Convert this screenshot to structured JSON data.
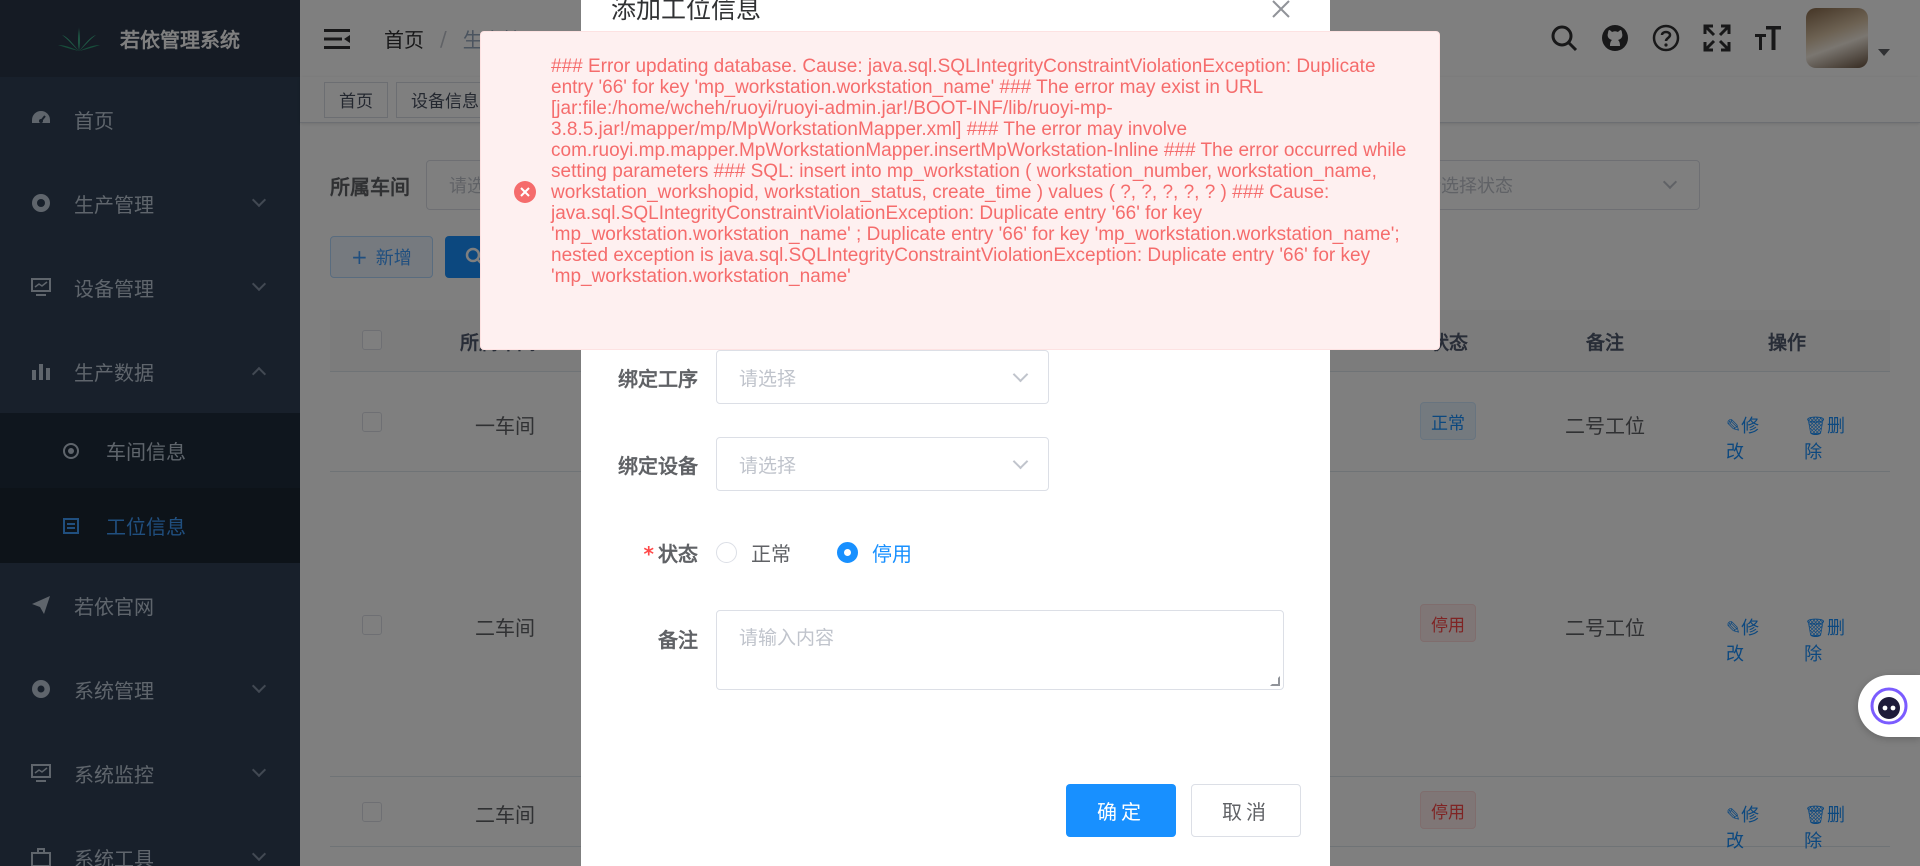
{
  "app": {
    "title": "若依管理系统"
  },
  "sidebar": {
    "items": [
      {
        "label": "首页",
        "icon": "dashboard-icon"
      },
      {
        "label": "生产管理",
        "icon": "settings-gear-icon"
      },
      {
        "label": "设备管理",
        "icon": "monitor-icon"
      },
      {
        "label": "生产数据",
        "icon": "bar-chart-icon"
      },
      {
        "label": "若依官网",
        "icon": "send-icon"
      },
      {
        "label": "系统管理",
        "icon": "system-gear-icon"
      },
      {
        "label": "系统监控",
        "icon": "monitor-icon"
      },
      {
        "label": "系统工具",
        "icon": "toolbox-icon"
      }
    ],
    "submenu": [
      {
        "label": "车间信息"
      },
      {
        "label": "工位信息"
      }
    ]
  },
  "navbar": {
    "breadcrumb_home": "首页",
    "breadcrumb_sep": "/",
    "breadcrumb_current": "生产管理"
  },
  "tags": [
    {
      "label": "首页"
    },
    {
      "label": "设备信息"
    }
  ],
  "filters": {
    "workshop_label": "所属车间",
    "workshop_placeholder": "请选择",
    "status_placeholder": "请选择状态"
  },
  "toolbar": {
    "add_label": "新增"
  },
  "table": {
    "headers": {
      "workshop": "所属车间",
      "status": "状态",
      "remark": "备注",
      "ops": "操作"
    },
    "rows": [
      {
        "workshop": "一车间",
        "status": "正常",
        "status_type": "ok",
        "remark": "二号工位"
      },
      {
        "workshop": "二车间",
        "status": "停用",
        "status_type": "stop",
        "remark": "二号工位"
      },
      {
        "workshop": "二车间",
        "status": "停用",
        "status_type": "stop",
        "remark": ""
      }
    ],
    "edit_label": "修改",
    "delete_label": "删除"
  },
  "dialog": {
    "title": "添加工位信息",
    "process_label": "绑定工序",
    "process_placeholder": "请选择",
    "device_label": "绑定设备",
    "device_placeholder": "请选择",
    "status_label": "状态",
    "status_required_mark": "*",
    "status_options": [
      {
        "label": "正常"
      },
      {
        "label": "停用"
      }
    ],
    "status_selected": "停用",
    "remark_label": "备注",
    "remark_placeholder": "请输入内容",
    "confirm_label": "确定",
    "cancel_label": "取消"
  },
  "error": {
    "message": "### Error updating database. Cause: java.sql.SQLIntegrityConstraintViolationException: Duplicate entry '66' for key 'mp_workstation.workstation_name' ### The error may exist in URL [jar:file:/home/wcheh/ruoyi/ruoyi-admin.jar!/BOOT-INF/lib/ruoyi-mp-3.8.5.jar!/mapper/mp/MpWorkstationMapper.xml] ### The error may involve com.ruoyi.mp.mapper.MpWorkstationMapper.insertMpWorkstation-Inline ### The error occurred while setting parameters ### SQL: insert into mp_workstation ( workstation_number, workstation_name, workstation_workshopid, workstation_status, create_time ) values ( ?, ?, ?, ?, ? ) ### Cause: java.sql.SQLIntegrityConstraintViolationException: Duplicate entry '66' for key 'mp_workstation.workstation_name' ; Duplicate entry '66' for key 'mp_workstation.workstation_name'; nested exception is java.sql.SQLIntegrityConstraintViolationException: Duplicate entry '66' for key 'mp_workstation.workstation_name'",
    "color": "#f56c6c"
  },
  "colors": {
    "primary": "#1890ff",
    "sidebar": "#304156",
    "danger": "#ff4949"
  }
}
